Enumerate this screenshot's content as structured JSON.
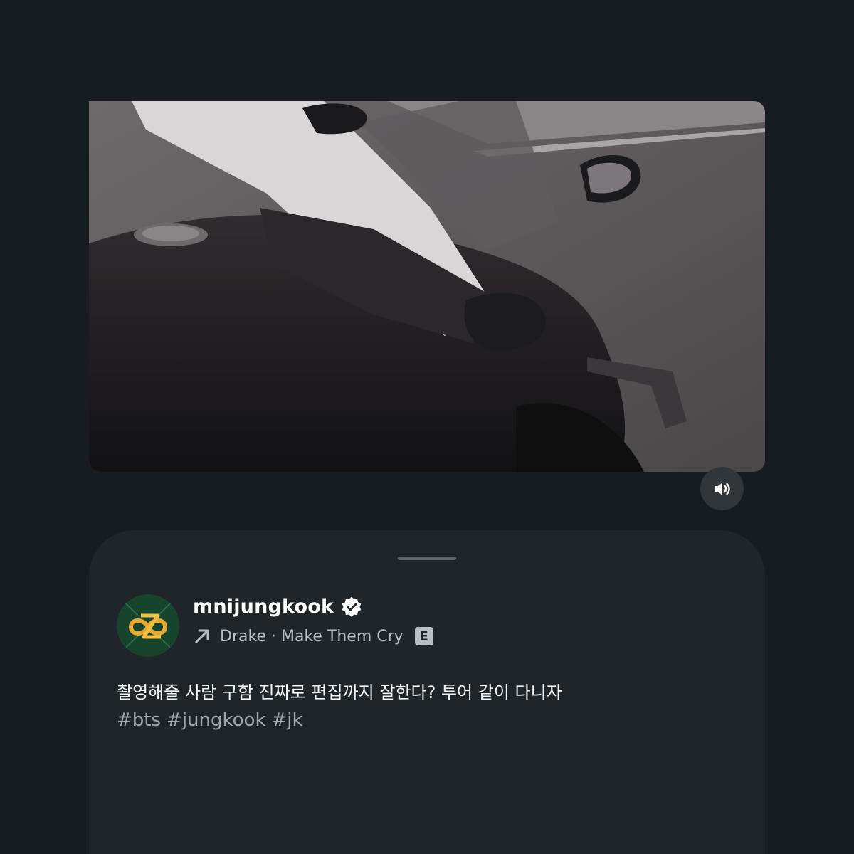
{
  "post": {
    "username": "mnijungkook",
    "verified": true,
    "music": {
      "artist": "Drake",
      "separator": "·",
      "title": "Make Them Cry",
      "explicit_badge": "E"
    },
    "caption": "촬영해줄 사람 구함 진짜로 편집까지 잘한다? 투어 같이 다니자",
    "hashtags": [
      "#bts",
      "#jungkook",
      "#jk"
    ]
  },
  "icons": {
    "mute": "speaker-volume-icon",
    "verified": "verified-badge-icon",
    "music": "arrow-up-right-icon"
  },
  "colors": {
    "background": "#161c1f",
    "sheet": "#1f2528",
    "hashtag": "#9fa8b0"
  }
}
